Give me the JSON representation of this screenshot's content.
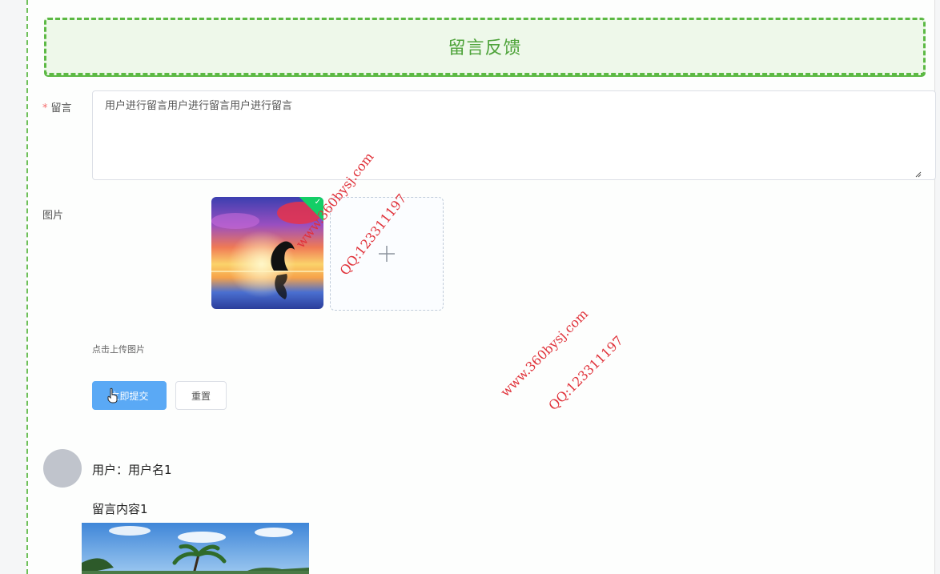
{
  "banner": {
    "title": "留言反馈"
  },
  "form": {
    "message_label": "留言",
    "required_mark": "*",
    "message_value": "用户进行留言用户进行留言用户进行留言",
    "image_label": "图片",
    "upload_hint": "点击上传图片",
    "submit_label": "立即提交",
    "reset_label": "重置"
  },
  "comments": [
    {
      "user": "用户：用户名1",
      "content": "留言内容1"
    }
  ],
  "watermarks": {
    "site": "www.360bysj.com",
    "qq": "QQ:123311197"
  },
  "colors": {
    "accent_green": "#5cb944",
    "primary_blue": "#5aa9f5",
    "success_badge": "#13ce66",
    "required_red": "#f56c6c",
    "watermark_red": "#e0323a"
  }
}
